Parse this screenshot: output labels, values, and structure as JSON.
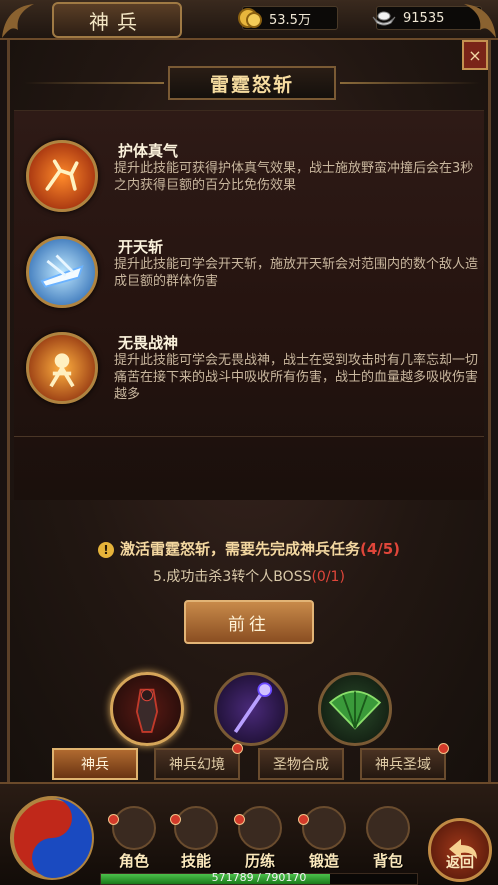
{
  "header": {
    "title": "神兵",
    "gold_amount": "53.5万",
    "ingot_amount": "91535"
  },
  "skill_group": {
    "title": "雷霆怒斩",
    "skills": [
      {
        "name": "护体真气",
        "desc": "提升此技能可获得护体真气效果，战士施放野蛮冲撞后会在3秒之内获得巨额的百分比免伤效果"
      },
      {
        "name": "开天斩",
        "desc": "提升此技能可学会开天斩，施放开天斩会对范围内的数个敌人造成巨额的群体伤害"
      },
      {
        "name": "无畏战神",
        "desc": "提升此技能可学会无畏战神，战士在受到攻击时有几率忘却一切痛苦在接下来的战斗中吸收所有伤害，战士的血量越多吸收伤害越多"
      }
    ]
  },
  "notice": {
    "warn_symbol": "!",
    "text": "激活雷霆怒斩，需要先完成神兵任务",
    "count": "(4/5)"
  },
  "task": {
    "text": "5.成功击杀3转个人BOSS",
    "count": "(0/1)"
  },
  "go_button": "前往",
  "close_symbol": "×",
  "tabs": [
    {
      "label": "神兵",
      "active": true,
      "badge": false
    },
    {
      "label": "神兵幻境",
      "active": false,
      "badge": true
    },
    {
      "label": "圣物合成",
      "active": false,
      "badge": false
    },
    {
      "label": "神兵圣域",
      "active": false,
      "badge": true
    }
  ],
  "nav": [
    {
      "label": "角色",
      "icon": "armor-icon"
    },
    {
      "label": "技能",
      "icon": "skill-icon"
    },
    {
      "label": "历练",
      "icon": "helmet-icon"
    },
    {
      "label": "锻造",
      "icon": "anvil-icon"
    },
    {
      "label": "背包",
      "icon": "bag-icon"
    }
  ],
  "back_label": "返回",
  "exp": {
    "text": "571789 / 790170",
    "fraction": 0.7236
  },
  "colors": {
    "accent_gold": "#d6a65a",
    "warning_red": "#e0463a",
    "exp_green": "#4cc04c"
  }
}
